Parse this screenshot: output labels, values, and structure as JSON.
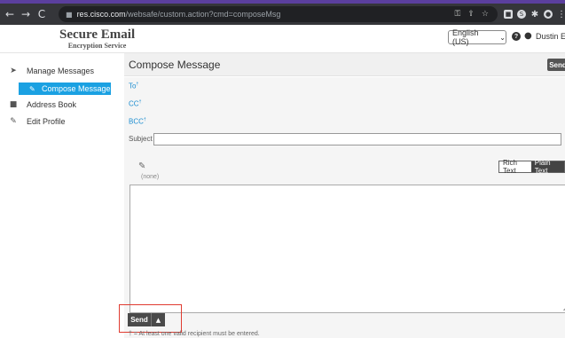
{
  "browser": {
    "back_glyph": "←",
    "forward_glyph": "→",
    "reload_glyph": "C",
    "url_domain": "res.cisco.com",
    "url_path": "/websafe/custom.action?cmd=composeMsg",
    "ext_glyphs": [
      "■",
      "S",
      "✱",
      "●",
      "⋮"
    ]
  },
  "header": {
    "brand_title": "Secure Email",
    "brand_subtitle": "Encryption Service",
    "language": "English (US)",
    "help_glyph": "?",
    "user_name": "Dustin Elken"
  },
  "sidebar": {
    "items": [
      {
        "label": "Manage Messages",
        "icon": "arrow-icon",
        "glyph": "➤"
      },
      {
        "label": "Compose Message",
        "icon": "pencil-icon",
        "glyph": "✎"
      },
      {
        "label": "Address Book",
        "icon": "book-icon",
        "glyph": "■"
      },
      {
        "label": "Edit Profile",
        "icon": "edit-icon",
        "glyph": "✎"
      }
    ]
  },
  "compose": {
    "title": "Compose Message",
    "send_top": "Send",
    "to_label": "To",
    "cc_label": "CC",
    "bcc_label": "BCC",
    "required_mark": "†",
    "subject_label": "Subject",
    "subject_value": "",
    "attachment_glyph": "✎",
    "attachments_none": "(none)",
    "format_rich": "Rich Text",
    "format_plain": "Plain Text",
    "send_bottom": "Send",
    "send_caret": "▲",
    "footnote": "† = At least one valid recipient must be entered."
  },
  "colors": {
    "accent": "#1ba1e2",
    "highlight": "#e03c31"
  }
}
